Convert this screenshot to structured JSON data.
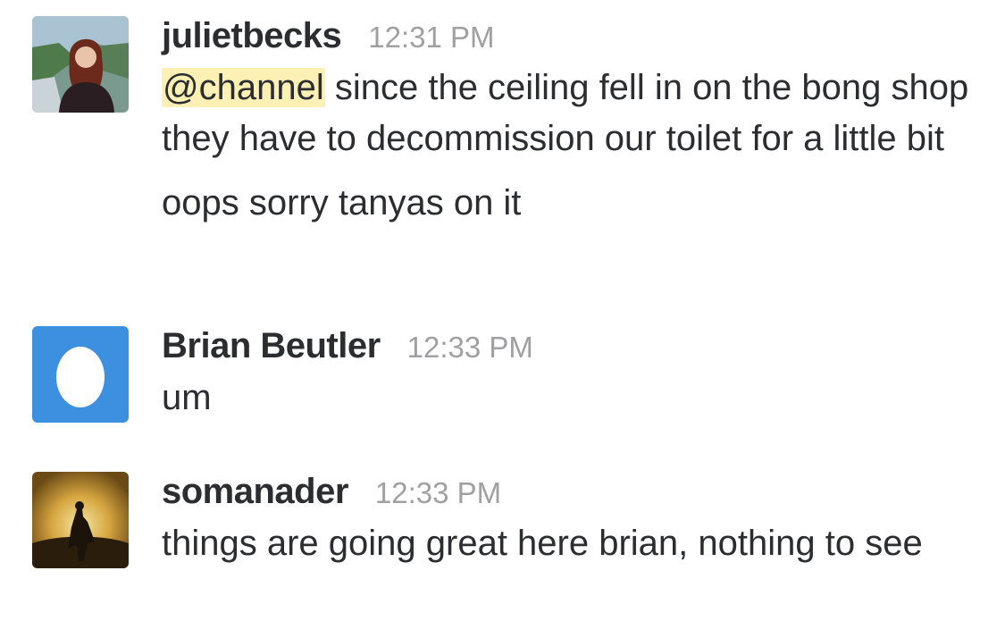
{
  "messages": [
    {
      "username": "julietbecks",
      "timestamp": "12:31 PM",
      "avatar_icon": "user-photo-avatar",
      "lines": [
        {
          "mention": "@channel",
          "text": " since the ceiling fell in on the bong shop they have to decommission our toilet for a little bit"
        },
        {
          "text": "oops sorry tanyas on it"
        }
      ]
    },
    {
      "username": "Brian Beutler",
      "timestamp": "12:33 PM",
      "avatar_icon": "egg-avatar",
      "lines": [
        {
          "text": "um"
        }
      ]
    },
    {
      "username": "somanader",
      "timestamp": "12:33 PM",
      "avatar_icon": "silhouette-sunset-avatar",
      "lines": [
        {
          "text": "things are going great here brian, nothing to see"
        }
      ]
    }
  ],
  "colors": {
    "mention_highlight": "#fcf0b5",
    "timestamp": "#a0a0a2",
    "text": "#2c2d30",
    "egg_avatar_bg": "#3d8fe0"
  }
}
